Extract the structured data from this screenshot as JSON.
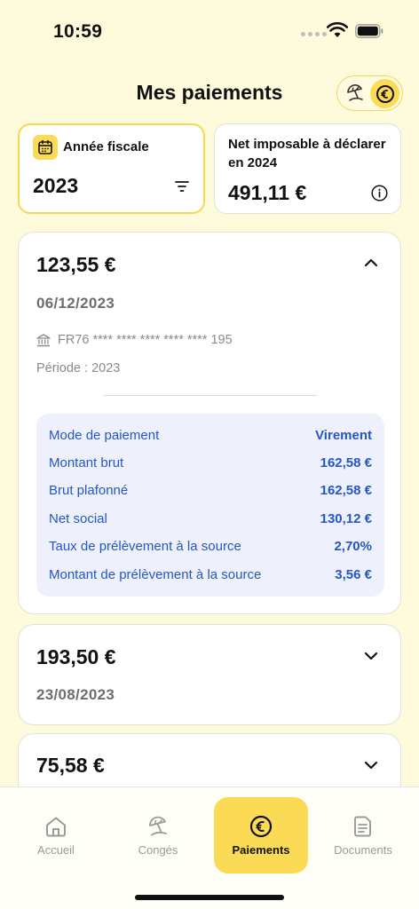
{
  "status_bar": {
    "time": "10:59"
  },
  "header": {
    "title": "Mes paiements"
  },
  "mode_switch": {
    "left_icon": "beach-umbrella-icon",
    "right_icon": "euro-icon",
    "active": "right"
  },
  "fiscal_card": {
    "label": "Année fiscale",
    "year": "2023"
  },
  "net_card": {
    "label": "Net imposable à déclarer en 2024",
    "value": "491,11 €"
  },
  "payments": [
    {
      "amount": "123,55 €",
      "date": "06/12/2023",
      "expanded": true,
      "iban": "FR76 **** **** **** **** **** 195",
      "period": "Période : 2023",
      "details": [
        {
          "label": "Mode de paiement",
          "value": "Virement"
        },
        {
          "label": "Montant brut",
          "value": "162,58 €"
        },
        {
          "label": "Brut plafonné",
          "value": "162,58 €"
        },
        {
          "label": "Net social",
          "value": "130,12 €"
        },
        {
          "label": "Taux de prélèvement à la source",
          "value": "2,70%"
        },
        {
          "label": "Montant de prélèvement à la source",
          "value": "3,56 €"
        }
      ]
    },
    {
      "amount": "193,50 €",
      "date": "23/08/2023",
      "expanded": false
    },
    {
      "amount": "75,58 €",
      "expanded": false
    }
  ],
  "bottom_nav": {
    "items": [
      {
        "label": "Accueil",
        "icon": "home-icon"
      },
      {
        "label": "Congés",
        "icon": "beach-umbrella-icon"
      },
      {
        "label": "Paiements",
        "icon": "euro-icon",
        "active": true
      },
      {
        "label": "Documents",
        "icon": "document-icon"
      }
    ]
  },
  "colors": {
    "background": "#fdfbdc",
    "accent_yellow": "#fbdb55",
    "detail_blue": "#2457c5",
    "detail_bg": "#eef1fb"
  }
}
